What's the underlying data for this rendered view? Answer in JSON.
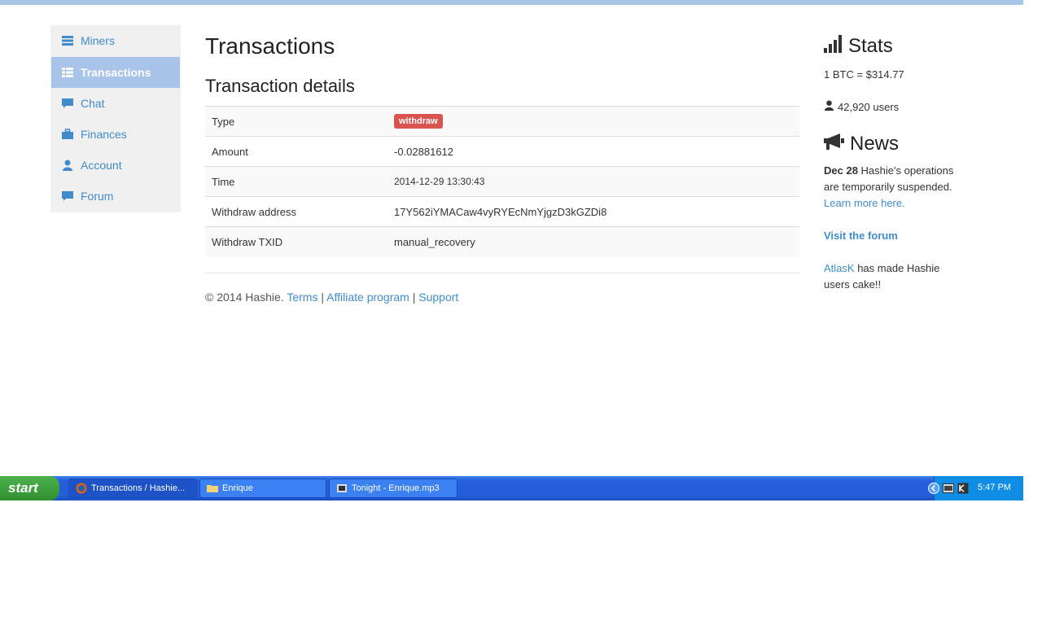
{
  "sidebar": {
    "items": [
      {
        "label": "Miners",
        "icon": "server-icon"
      },
      {
        "label": "Transactions",
        "icon": "table-icon",
        "active": true
      },
      {
        "label": "Chat",
        "icon": "comment-icon"
      },
      {
        "label": "Finances",
        "icon": "briefcase-icon"
      },
      {
        "label": "Account",
        "icon": "user-icon"
      },
      {
        "label": "Forum",
        "icon": "comment-icon"
      }
    ]
  },
  "main": {
    "title": "Transactions",
    "subtitle": "Transaction details",
    "details": [
      {
        "key": "Type",
        "value": "withdraw"
      },
      {
        "key": "Amount",
        "value": "-0.02881612"
      },
      {
        "key": "Time",
        "value": "2014-12-29 13:30:43"
      },
      {
        "key": "Withdraw address",
        "value": "17Y562iYMACaw4vyRYEcNmYjgzD3kGZDi8"
      },
      {
        "key": "Withdraw TXID",
        "value": "manual_recovery"
      }
    ],
    "badge_color": "#d9534f"
  },
  "footer": {
    "copyright": "© 2014 Hashie.",
    "terms": "Terms",
    "sep": "|",
    "affiliate": "Affiliate program",
    "support": "Support"
  },
  "stats": {
    "title": "Stats",
    "btc_rate": "1 BTC = $314.77",
    "users": "42,920 users"
  },
  "news": {
    "title": "News",
    "date": "Dec 28",
    "text": "Hashie's operations are temporarily suspended.",
    "learn_more": "Learn more here.",
    "forum_link": "Visit the forum",
    "user_link": "AtlasK",
    "user_text": "has made Hashie users cake!!"
  },
  "taskbar": {
    "start": "start",
    "tasks": [
      {
        "label": "Transactions / Hashie...",
        "icon": "firefox-icon"
      },
      {
        "label": "Enrique",
        "icon": "folder-icon"
      },
      {
        "label": "Tonight - Enrique.mp3",
        "icon": "media-player-icon"
      }
    ],
    "clock": "5:47 PM"
  },
  "colors": {
    "accent": "#428bca",
    "active_nav": "#a8c4e8"
  }
}
